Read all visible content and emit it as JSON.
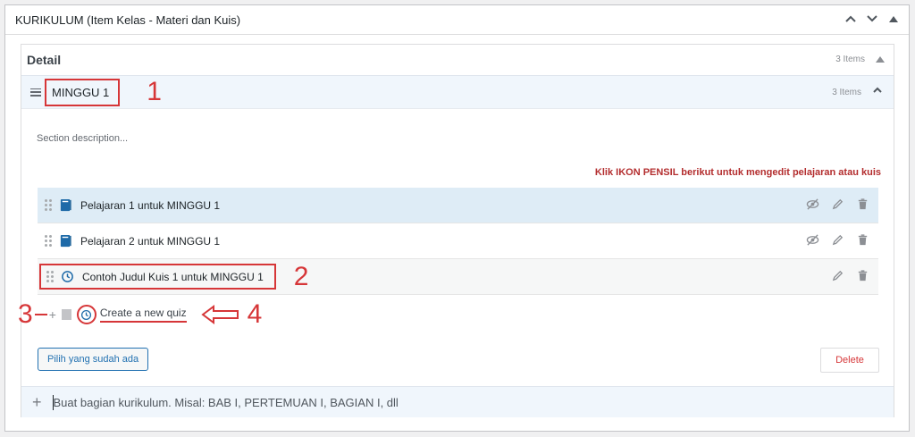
{
  "metabox": {
    "title": "KURIKULUM (Item Kelas - Materi dan Kuis)"
  },
  "detail": {
    "label": "Detail",
    "count": "3 Items"
  },
  "section": {
    "title": "MINGGU 1",
    "count": "3 Items",
    "description_placeholder": "Section description...",
    "hint": "Klik IKON PENSIL berikut untuk mengedit pelajaran atau kuis"
  },
  "annotations": {
    "n1": "1",
    "n2": "2",
    "n3": "3",
    "n4": "4"
  },
  "items": [
    {
      "name": "Pelajaran 1 untuk MINGGU 1",
      "type": "lesson-icon"
    },
    {
      "name": "Pelajaran 2 untuk MINGGU 1",
      "type": "lesson-icon"
    },
    {
      "name": "Contoh Judul Kuis 1 untuk MINGGU 1",
      "type": "quiz-icon"
    }
  ],
  "new_item": {
    "label": "Create a new quiz"
  },
  "buttons": {
    "pilih": "Pilih yang sudah ada",
    "delete": "Delete"
  },
  "new_section": {
    "placeholder": "Buat bagian kurikulum. Misal: BAB I, PERTEMUAN I, BAGIAN I, dll"
  },
  "colors": {
    "accent": "#2271b1",
    "annotation_red": "#d63638",
    "lesson_icon": "#1e6aa8"
  }
}
